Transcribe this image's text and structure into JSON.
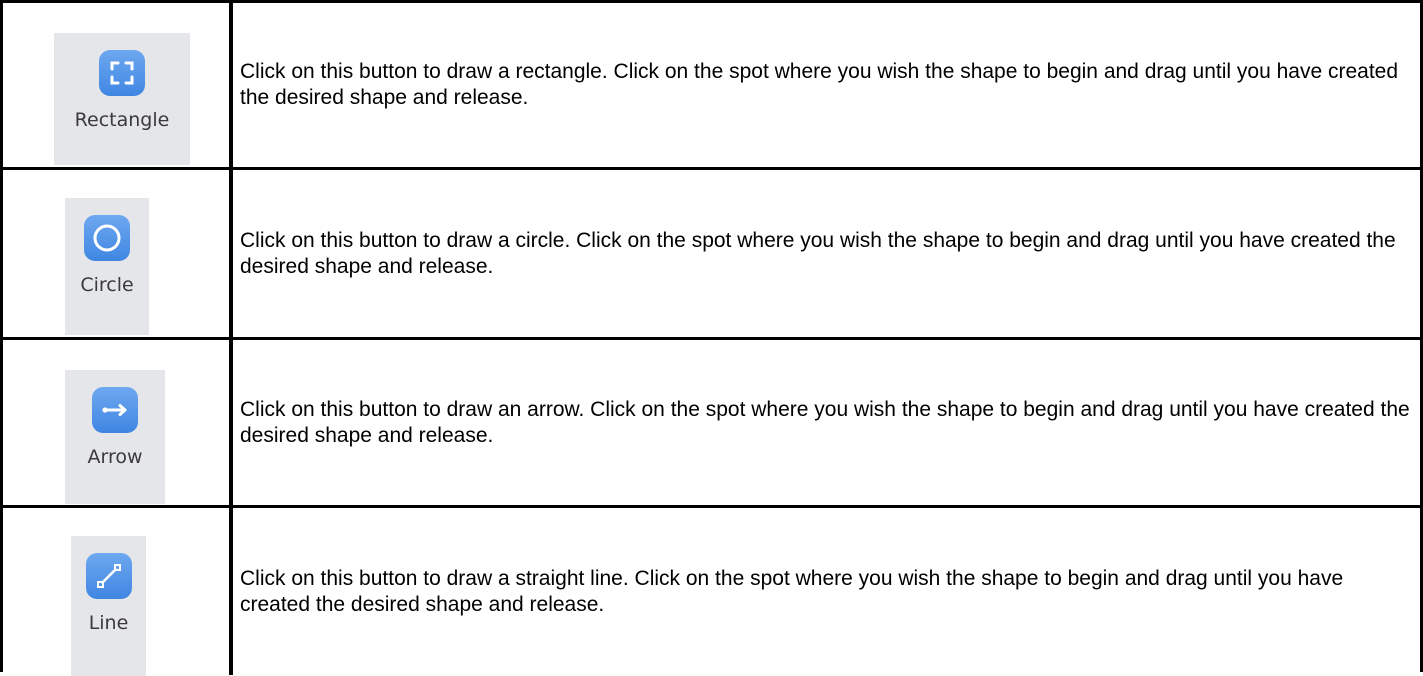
{
  "rows": [
    {
      "button": {
        "label": "Rectangle",
        "icon": "rectangle-select-icon"
      },
      "description": "Click on this button to draw a rectangle. Click on the spot where you wish the shape to begin and drag until you have created the desired shape and release."
    },
    {
      "button": {
        "label": "Circle",
        "icon": "circle-icon"
      },
      "description": "Click on this button to draw a circle. Click on the spot where you wish the shape to begin and drag until you have created the desired shape and release."
    },
    {
      "button": {
        "label": "Arrow",
        "icon": "arrow-icon"
      },
      "description": "Click on this button to draw an arrow. Click on the spot where you wish the shape to begin and drag until you have created the desired shape and release."
    },
    {
      "button": {
        "label": "Line",
        "icon": "line-icon"
      },
      "description": "Click on this button to draw a straight line. Click on the spot where you wish the shape to begin and drag until you have created the desired shape and release."
    }
  ],
  "colors": {
    "icon_blue": "#4a8fe6",
    "button_bg": "#e5e6e9",
    "border": "#000000"
  }
}
